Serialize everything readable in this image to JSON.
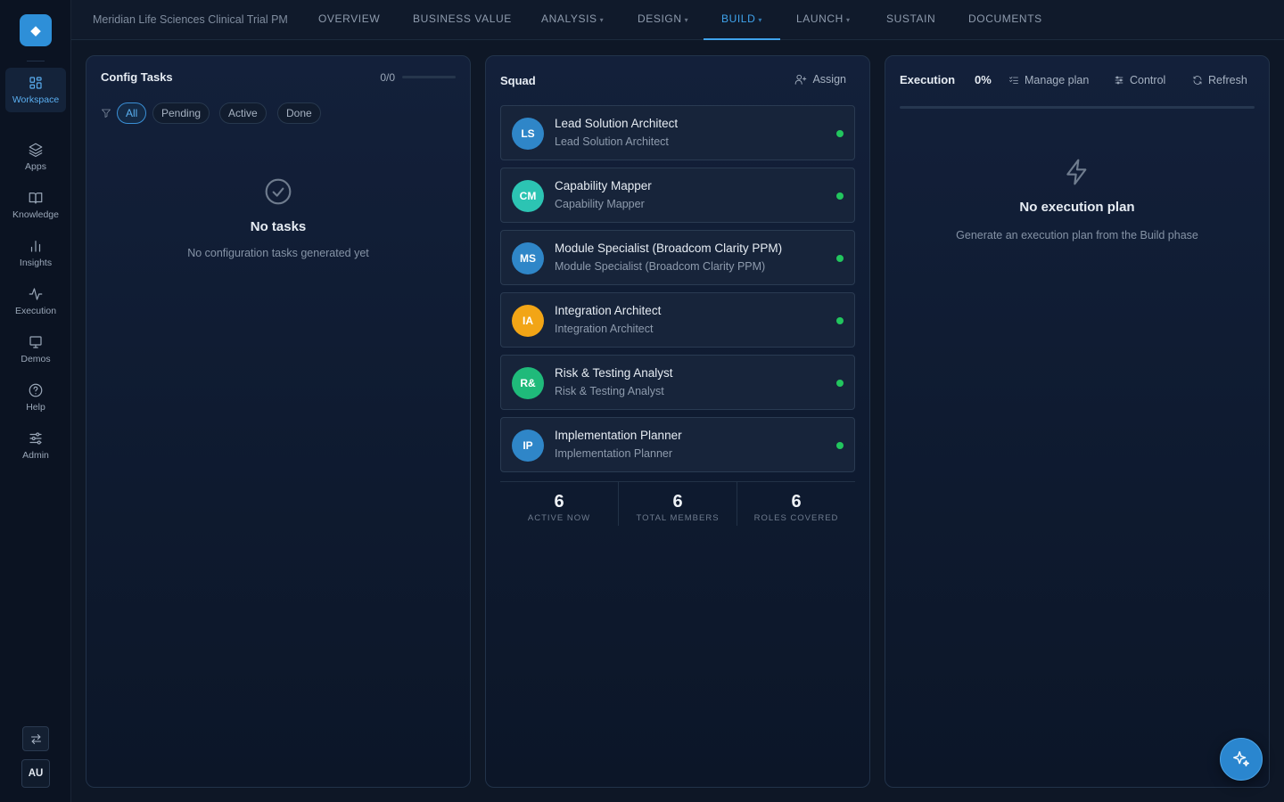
{
  "sidebar": {
    "logo_icon": "diamond-logo-icon",
    "items": [
      {
        "label": "Workspace",
        "icon": "grid-icon"
      },
      {
        "label": "Apps",
        "icon": "layers-icon"
      },
      {
        "label": "Knowledge",
        "icon": "book-icon"
      },
      {
        "label": "Insights",
        "icon": "bar-chart-icon"
      },
      {
        "label": "Execution",
        "icon": "activity-icon"
      },
      {
        "label": "Demos",
        "icon": "monitor-icon"
      },
      {
        "label": "Help",
        "icon": "help-circle-icon"
      },
      {
        "label": "Admin",
        "icon": "sliders-icon"
      }
    ],
    "active_item": "Workspace",
    "user_initials": "AU"
  },
  "topnav": {
    "project_name": "Meridian Life Sciences Clinical Trial PM",
    "tabs": [
      {
        "label": "OVERVIEW"
      },
      {
        "label": "BUSINESS VALUE"
      },
      {
        "label": "ANALYSIS",
        "caret": "▾"
      },
      {
        "label": "DESIGN",
        "caret": "▾"
      },
      {
        "label": "BUILD",
        "caret": "▾"
      },
      {
        "label": "LAUNCH",
        "caret": "▾"
      },
      {
        "label": "SUSTAIN"
      },
      {
        "label": "DOCUMENTS"
      }
    ],
    "active_tab": "BUILD"
  },
  "config_tasks": {
    "title": "Config Tasks",
    "count": "0/0",
    "progress": 0,
    "filters": [
      "All",
      "Pending",
      "Active",
      "Done"
    ],
    "active_filter": "All",
    "empty_title": "No tasks",
    "empty_subtitle": "No configuration tasks generated yet"
  },
  "squad": {
    "title": "Squad",
    "assign_label": "Assign",
    "members": [
      {
        "initials": "LS",
        "name": "Lead Solution Architect",
        "role": "Lead Solution Architect",
        "color": "#2f86c8"
      },
      {
        "initials": "CM",
        "name": "Capability Mapper",
        "role": "Capability Mapper",
        "color": "#2cc4b3"
      },
      {
        "initials": "MS",
        "name": "Module Specialist (Broadcom Clarity PPM)",
        "role": "Module Specialist (Broadcom Clarity PPM)",
        "color": "#2f86c8"
      },
      {
        "initials": "IA",
        "name": "Integration Architect",
        "role": "Integration Architect",
        "color": "#f2a516"
      },
      {
        "initials": "R&",
        "name": "Risk & Testing Analyst",
        "role": "Risk & Testing Analyst",
        "color": "#1fba7a"
      },
      {
        "initials": "IP",
        "name": "Implementation Planner",
        "role": "Implementation Planner",
        "color": "#2f86c8"
      }
    ],
    "status_color": "#22c55e",
    "stats": [
      {
        "value": "6",
        "label": "ACTIVE NOW"
      },
      {
        "value": "6",
        "label": "TOTAL MEMBERS"
      },
      {
        "value": "6",
        "label": "ROLES COVERED"
      }
    ]
  },
  "execution": {
    "title": "Execution",
    "percent": "0%",
    "progress": 0,
    "manage_label": "Manage plan",
    "control_label": "Control",
    "refresh_label": "Refresh",
    "empty_title": "No execution plan",
    "empty_subtitle": "Generate an execution plan from the Build phase"
  },
  "colors": {
    "accent": "#3fa3ec",
    "background": "#0e1726"
  }
}
